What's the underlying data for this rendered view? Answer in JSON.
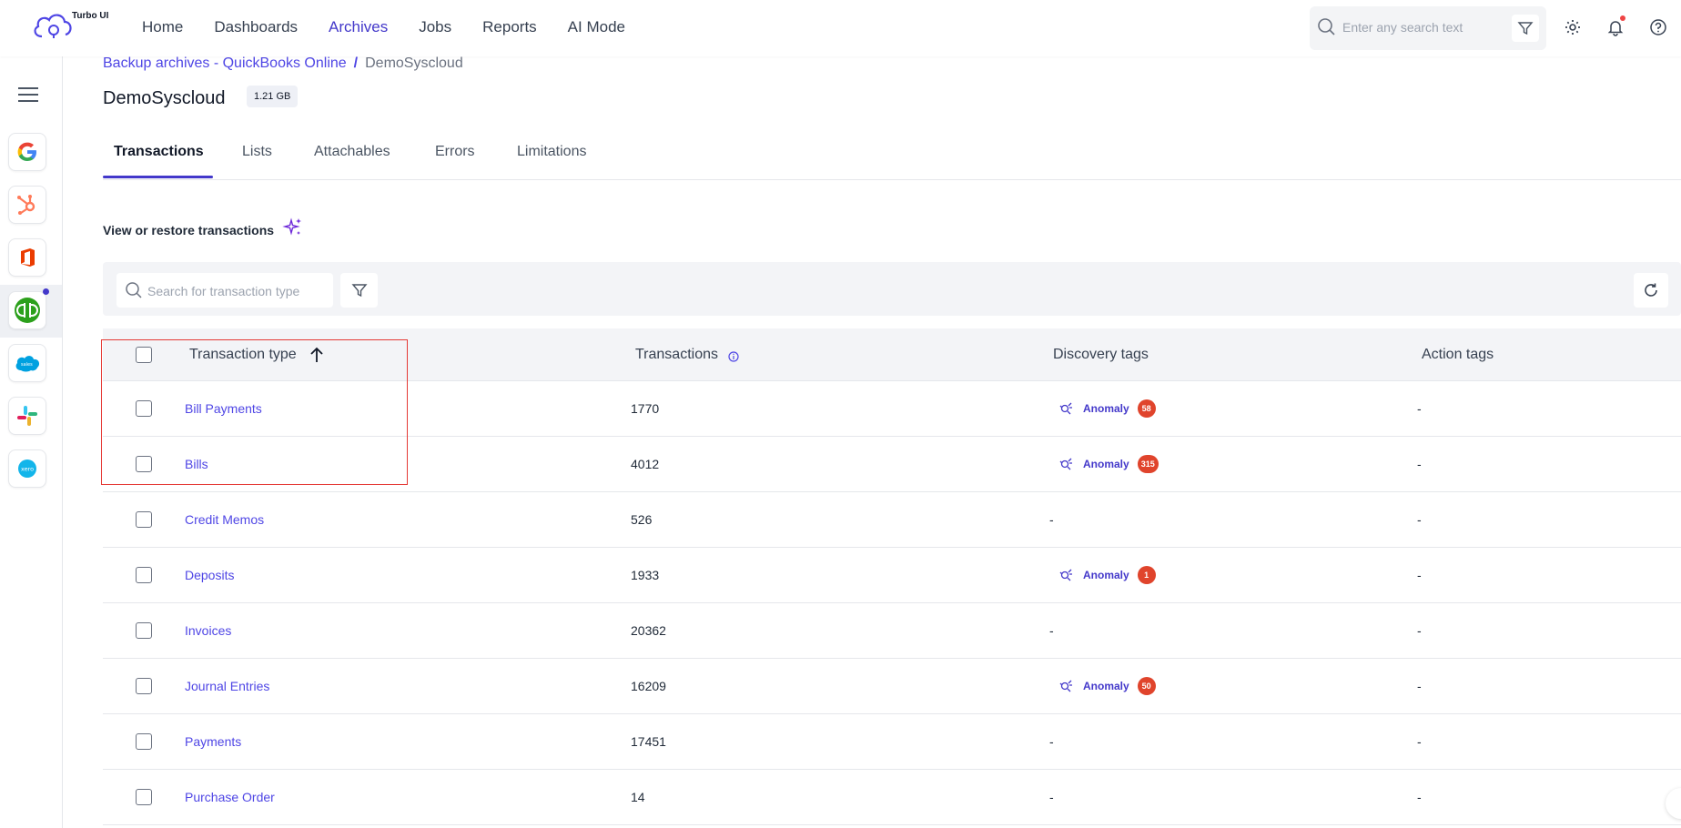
{
  "brand": {
    "logo_text": "Turbo UI"
  },
  "nav": {
    "items": [
      {
        "label": "Home"
      },
      {
        "label": "Dashboards"
      },
      {
        "label": "Archives"
      },
      {
        "label": "Jobs"
      },
      {
        "label": "Reports"
      },
      {
        "label": "AI Mode"
      }
    ],
    "active": "Archives",
    "search_placeholder": "Enter any search text"
  },
  "sidebar": {
    "apps": [
      "google-icon",
      "hubspot-icon",
      "office-icon",
      "quickbooks-icon",
      "salesforce-icon",
      "slack-icon",
      "xero-icon"
    ],
    "active_app": "quickbooks-icon"
  },
  "breadcrumb": {
    "link": "Backup archives -  QuickBooks Online",
    "separator": "/",
    "current": "DemoSyscloud"
  },
  "page": {
    "title": "DemoSyscloud",
    "size": "1.21 GB"
  },
  "tabs": [
    {
      "label": "Transactions"
    },
    {
      "label": "Lists"
    },
    {
      "label": "Attachables"
    },
    {
      "label": "Errors"
    },
    {
      "label": "Limitations"
    }
  ],
  "section": {
    "title": "View or restore transactions"
  },
  "toolbar": {
    "search_placeholder": "Search for transaction type"
  },
  "table": {
    "headers": {
      "type": "Transaction type",
      "transactions": "Transactions",
      "discovery": "Discovery tags",
      "action": "Action tags"
    },
    "rows": [
      {
        "type": "Bill Payments",
        "transactions": "1770",
        "discovery": "Anomaly",
        "count": "58",
        "action": "-"
      },
      {
        "type": "Bills",
        "transactions": "4012",
        "discovery": "Anomaly",
        "count": "315",
        "action": "-"
      },
      {
        "type": "Credit Memos",
        "transactions": "526",
        "discovery": "-",
        "count": "",
        "action": "-"
      },
      {
        "type": "Deposits",
        "transactions": "1933",
        "discovery": "Anomaly",
        "count": "1",
        "action": "-"
      },
      {
        "type": "Invoices",
        "transactions": "20362",
        "discovery": "-",
        "count": "",
        "action": "-"
      },
      {
        "type": "Journal Entries",
        "transactions": "16209",
        "discovery": "Anomaly",
        "count": "50",
        "action": "-"
      },
      {
        "type": "Payments",
        "transactions": "17451",
        "discovery": "-",
        "count": "",
        "action": "-"
      },
      {
        "type": "Purchase Order",
        "transactions": "14",
        "discovery": "-",
        "count": "",
        "action": "-"
      }
    ]
  },
  "colors": {
    "accent": "#4338ca",
    "link": "#4f46e5",
    "badge": "#e0442c",
    "highlight": "#e53935"
  }
}
